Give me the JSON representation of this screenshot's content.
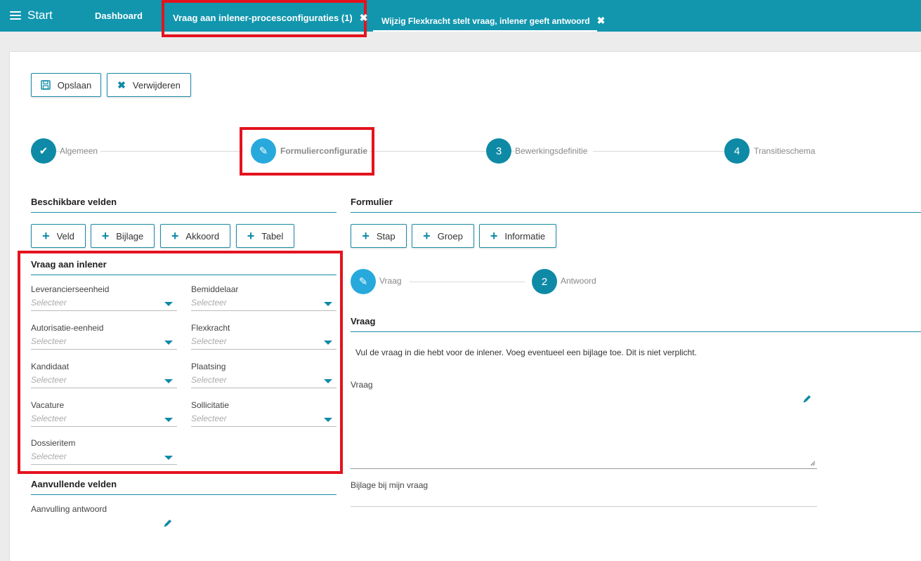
{
  "topbar": {
    "start_label": "Start",
    "tabs": [
      {
        "label": "Dashboard"
      },
      {
        "label": "Vraag aan inlener-procesconfiguraties (1)",
        "close": "✖"
      },
      {
        "label": "Wijzig Flexkracht stelt vraag, inlener geeft antwoord",
        "close": "✖"
      }
    ]
  },
  "toolbar": {
    "save_label": "Opslaan",
    "delete_label": "Verwijderen"
  },
  "steps": [
    {
      "marker": "✔",
      "label": "Algemeen"
    },
    {
      "marker": "✎",
      "label": "Formulierconfiguratie"
    },
    {
      "marker": "3",
      "label": "Bewerkingsdefinitie"
    },
    {
      "marker": "4",
      "label": "Transitieschema"
    }
  ],
  "left": {
    "title": "Beschikbare velden",
    "buttons": [
      "Veld",
      "Bijlage",
      "Akkoord",
      "Tabel"
    ],
    "group_title": "Vraag aan inlener",
    "placeholder": "Selecteer",
    "fields": [
      "Leverancierseenheid",
      "Bemiddelaar",
      "Autorisatie-eenheid",
      "Flexkracht",
      "Kandidaat",
      "Plaatsing",
      "Vacature",
      "Sollicitatie",
      "Dossieritem"
    ],
    "extra_title": "Aanvullende velden",
    "extra_field": "Aanvulling antwoord"
  },
  "right": {
    "title": "Formulier",
    "buttons": [
      "Stap",
      "Groep",
      "Informatie"
    ],
    "substeps": [
      {
        "marker": "✎",
        "label": "Vraag"
      },
      {
        "marker": "2",
        "label": "Antwoord"
      }
    ],
    "section_title": "Vraag",
    "instruction": "Vul de vraag in die hebt voor de inlener.  Voeg eventueel een bijlage toe. Dit is niet verplicht.",
    "field1_label": "Vraag",
    "field2_label": "Bijlage bij mijn vraag"
  },
  "colors": {
    "accent": "#0e8aa6",
    "topbar": "#1196ae",
    "highlight": "#e3131e"
  }
}
